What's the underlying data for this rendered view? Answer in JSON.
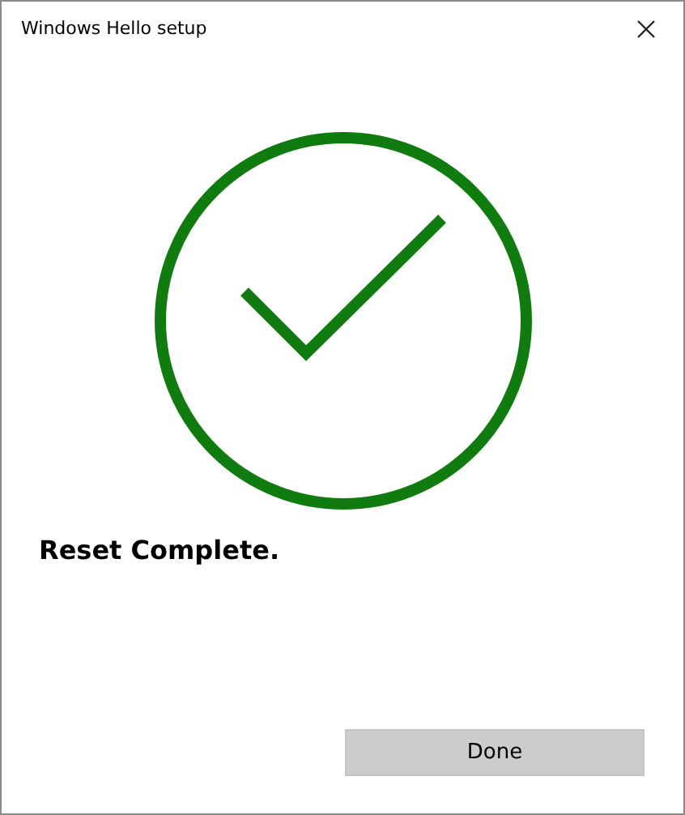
{
  "window": {
    "title": "Windows Hello setup"
  },
  "status": {
    "kind": "success",
    "heading": "Reset Complete."
  },
  "buttons": [
    {
      "label": "Done"
    }
  ]
}
